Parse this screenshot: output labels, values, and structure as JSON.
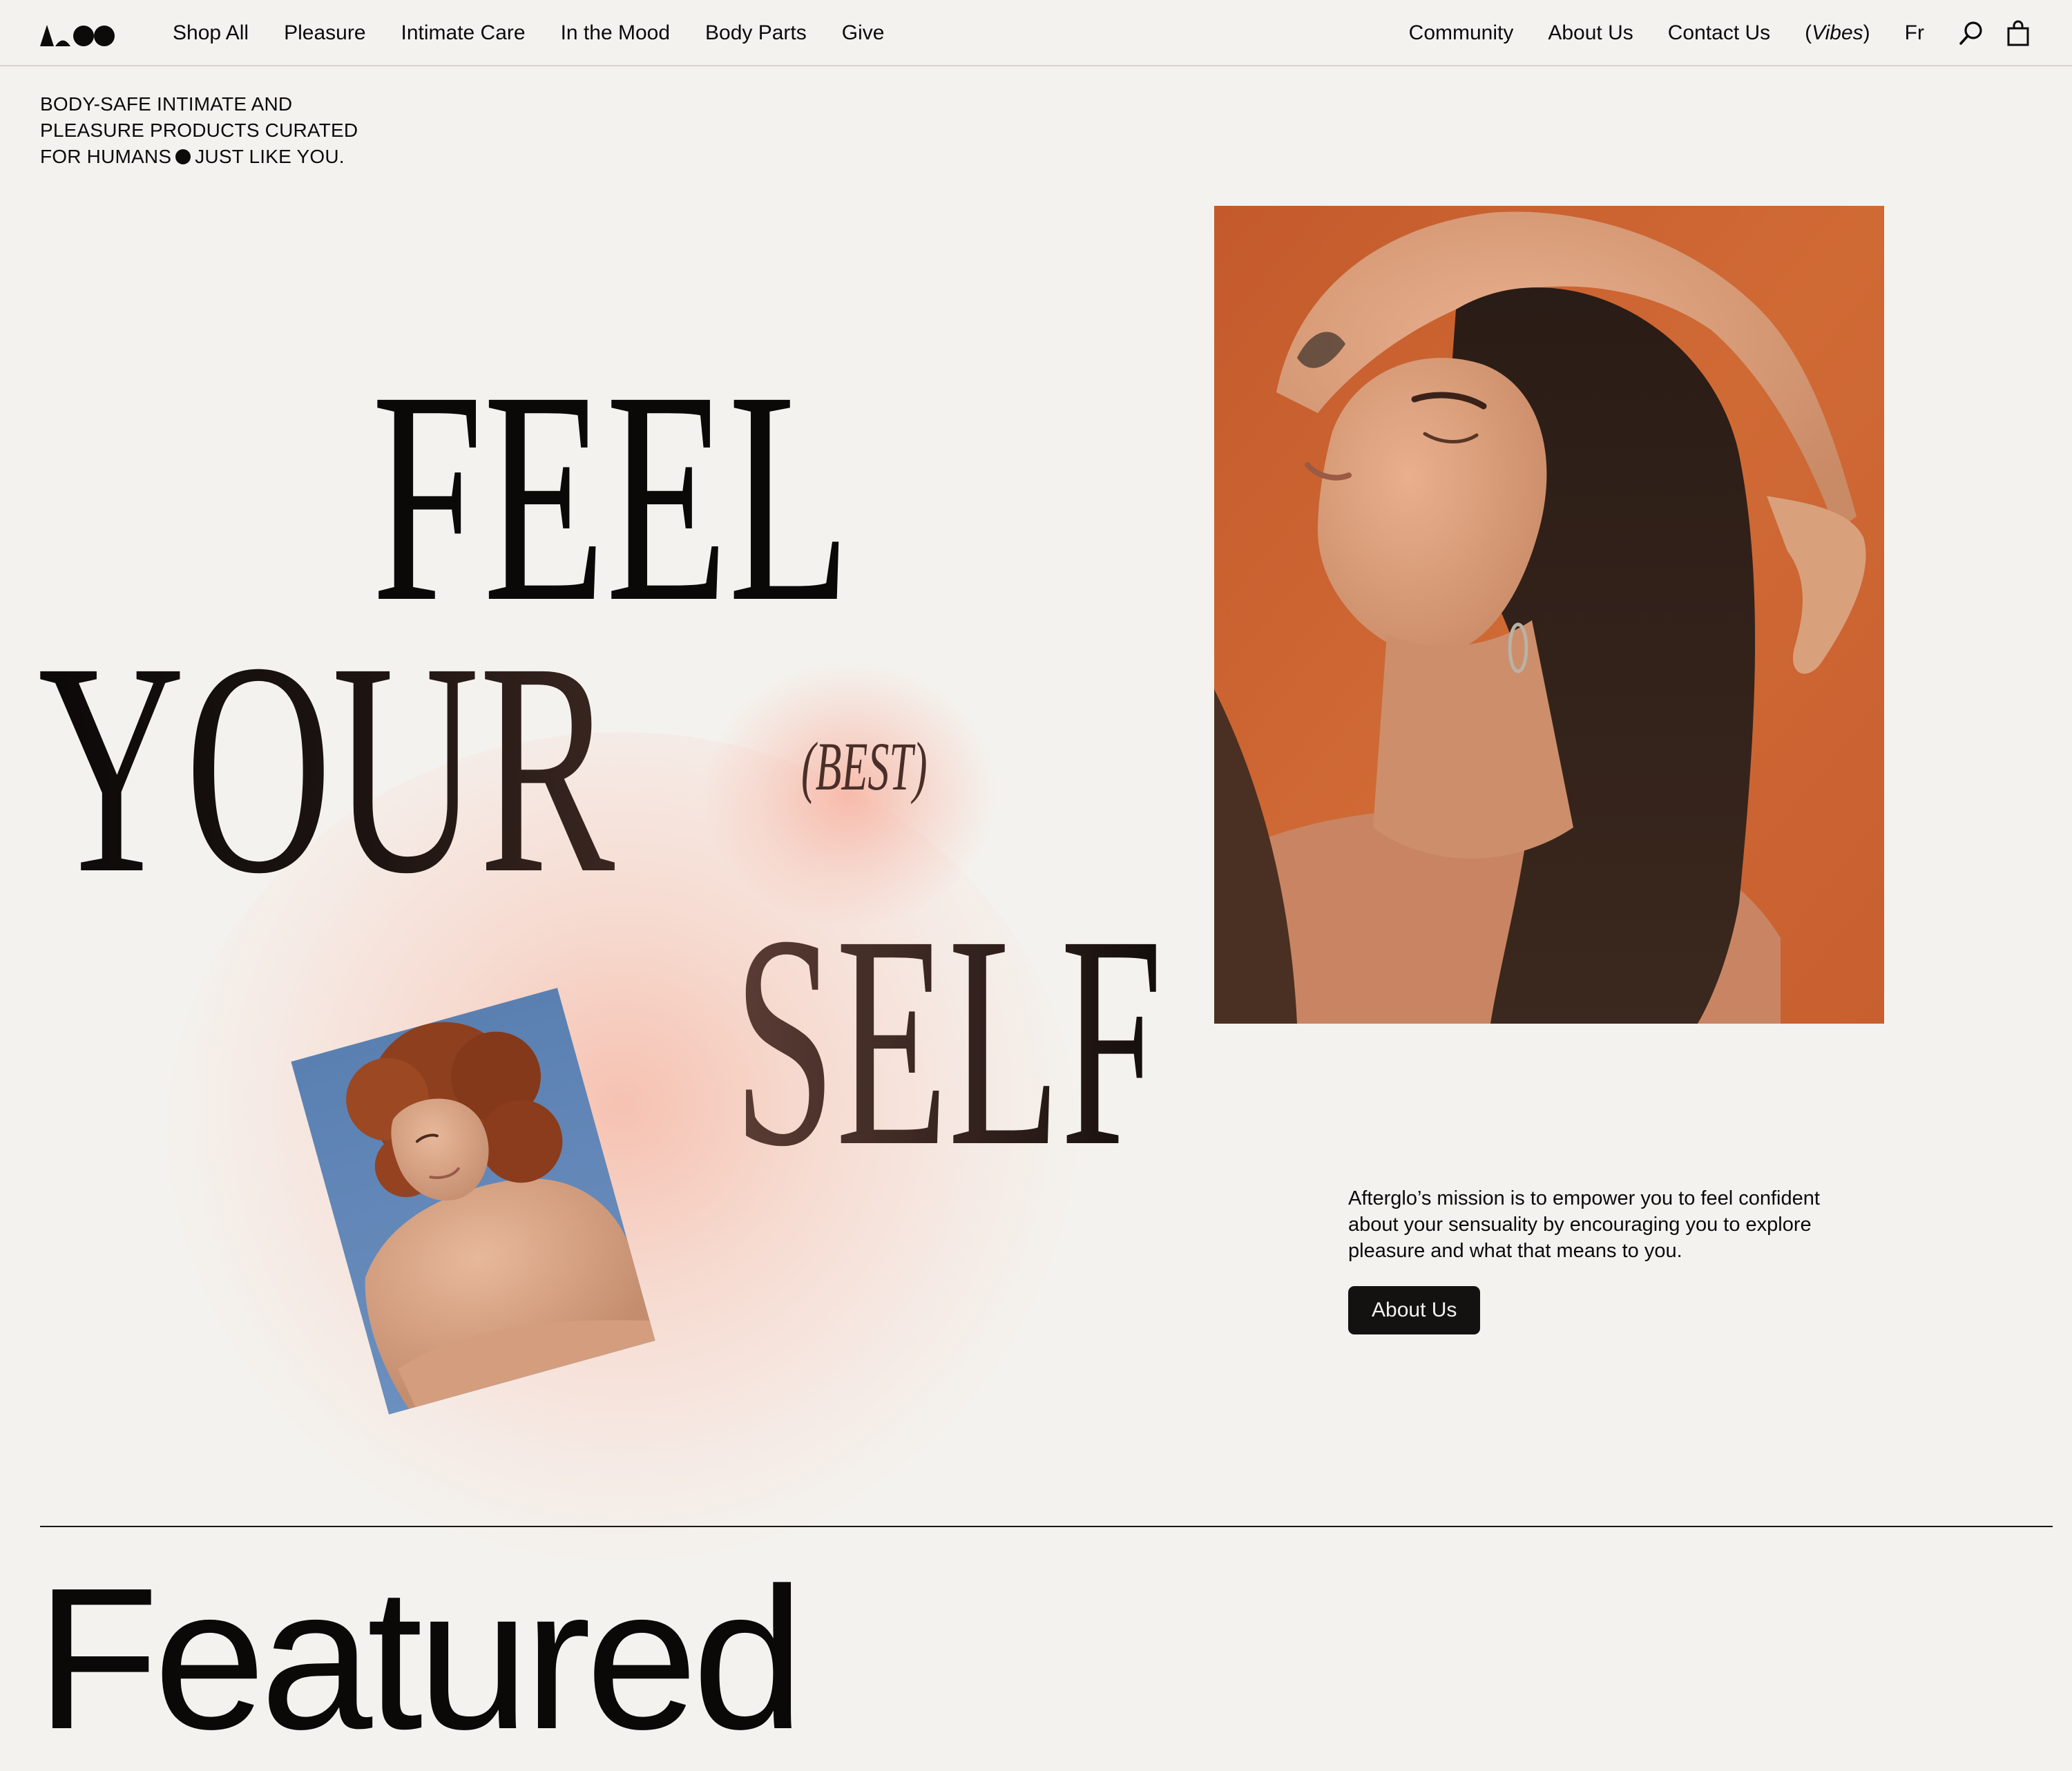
{
  "nav": {
    "left_items": [
      "Shop All",
      "Pleasure",
      "Intimate Care",
      "In the Mood",
      "Body Parts",
      "Give"
    ],
    "right_items": [
      "Community",
      "About Us",
      "Contact Us"
    ],
    "vibes": {
      "open": "(",
      "label": "Vibes",
      "close": ")"
    },
    "language": "Fr",
    "icons": [
      "afterglo-logo",
      "search-icon",
      "cart-icon"
    ]
  },
  "hero": {
    "tagline_lines": [
      "BODY-SAFE INTIMATE AND",
      "PLEASURE PRODUCTS CURATED"
    ],
    "tagline_last_before": "FOR HUMANS",
    "tagline_last_after": "JUST LIKE YOU.",
    "headline": {
      "word1": "FEEL",
      "word2": "YOUR",
      "word3": "(BEST)",
      "word4": "SELF"
    },
    "glow_color": "#f7b4a0"
  },
  "mission": {
    "text": "Afterglo’s mission is to empower you to feel confident about your sensuality by encouraging you to explore pleasure and what that means to you.",
    "button_label": "About Us"
  },
  "featured": {
    "title": "Featured"
  },
  "colors": {
    "background": "#f4f2ee",
    "text": "#0d0b0a",
    "button_bg": "#141210",
    "photo_large_bg": "#c8602f",
    "photo_small_bg": "#5e85b4"
  }
}
